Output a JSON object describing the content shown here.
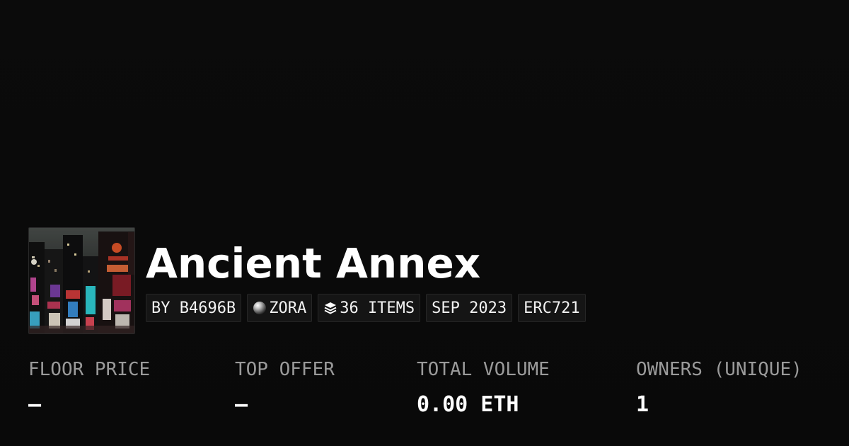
{
  "collection": {
    "title": "Ancient Annex",
    "tags": {
      "creator": "BY B4696B",
      "network": "ZORA",
      "network_icon": "zora-orb-icon",
      "items": "36 ITEMS",
      "items_icon": "layers-icon",
      "date": "SEP 2023",
      "standard": "ERC721"
    }
  },
  "stats": {
    "floor_price": {
      "label": "FLOOR PRICE",
      "value": "–"
    },
    "top_offer": {
      "label": "TOP OFFER",
      "value": "–"
    },
    "total_volume": {
      "label": "TOTAL VOLUME",
      "value": "0.00 ETH"
    },
    "owners": {
      "label": "OWNERS (UNIQUE)",
      "value": "1"
    }
  },
  "colors": {
    "background": "#0a0a0a",
    "tag_background": "#151515",
    "label": "#9a9a9a",
    "text": "#ffffff"
  }
}
